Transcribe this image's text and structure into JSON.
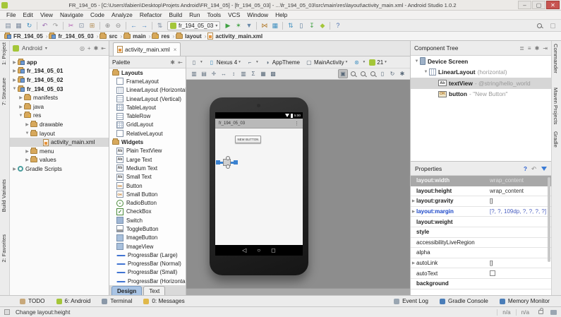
{
  "window": {
    "title": "FR_194_05 - [C:\\Users\\fabien\\Desktop\\Projets Android\\FR_194_05] - [fr_194_05_03] - ...\\fr_194_05_03\\src\\main\\res\\layout\\activity_main.xml - Android Studio 1.0.2"
  },
  "menu_bar": {
    "items": [
      "File",
      "Edit",
      "View",
      "Navigate",
      "Code",
      "Analyze",
      "Refactor",
      "Build",
      "Run",
      "Tools",
      "VCS",
      "Window",
      "Help"
    ]
  },
  "toolbar": {
    "run_config": "fr_194_05_03",
    "icons": [
      {
        "name": "open-icon",
        "glyph": "▤",
        "color": "#7d8ca0"
      },
      {
        "name": "save-icon",
        "glyph": "▦",
        "color": "#7d8ca0"
      },
      {
        "name": "sync-icon",
        "glyph": "↻",
        "color": "#3f8fc0"
      },
      {
        "name": "sep"
      },
      {
        "name": "undo-icon",
        "glyph": "↶",
        "color": "#9a68b0"
      },
      {
        "name": "redo-icon",
        "glyph": "↷",
        "color": "#9a9a9a"
      },
      {
        "name": "sep"
      },
      {
        "name": "cut-icon",
        "glyph": "✂",
        "color": "#b05ab0"
      },
      {
        "name": "copy-icon",
        "glyph": "⊡",
        "color": "#7d8ca0"
      },
      {
        "name": "paste-icon",
        "glyph": "⊞",
        "color": "#b08a50"
      },
      {
        "name": "sep"
      },
      {
        "name": "find-icon",
        "glyph": "⊕",
        "color": "#8a8a8a"
      },
      {
        "name": "replace-icon",
        "glyph": "⊖",
        "color": "#8a8a8a"
      },
      {
        "name": "sep"
      },
      {
        "name": "back-icon",
        "glyph": "←",
        "color": "#3f7fc0"
      },
      {
        "name": "forward-icon",
        "glyph": "→",
        "color": "#3f7fc0"
      },
      {
        "name": "sep"
      },
      {
        "name": "sort-icon",
        "glyph": "⇅",
        "color": "#7d8ca0"
      },
      {
        "name": "run-config-box"
      },
      {
        "name": "run-icon",
        "glyph": "▶",
        "color": "#3fa142"
      },
      {
        "name": "debug-icon",
        "glyph": "✶",
        "color": "#3fa142"
      },
      {
        "name": "install-icon",
        "glyph": "▼",
        "color": "#6888a8"
      },
      {
        "name": "sep"
      },
      {
        "name": "attach-debugger-icon",
        "glyph": "⋈",
        "color": "#b07828"
      },
      {
        "name": "avd-manager-icon",
        "glyph": "▦",
        "color": "#3f8fc0"
      },
      {
        "name": "sep"
      },
      {
        "name": "sync-gradle-icon",
        "glyph": "⇅",
        "color": "#3f8fc0"
      },
      {
        "name": "device-monitor-icon",
        "glyph": "▯",
        "color": "#5a7a9a"
      },
      {
        "name": "sdk-manager-icon",
        "glyph": "↧",
        "color": "#3fa142"
      },
      {
        "name": "android-icon",
        "glyph": "◆",
        "color": "#a4c639"
      },
      {
        "name": "sep"
      },
      {
        "name": "help-icon",
        "glyph": "?",
        "color": "#4a6fb0"
      }
    ]
  },
  "breadcrumbs": {
    "items": [
      "FR_194_05",
      "fr_194_05_03",
      "src",
      "main",
      "res",
      "layout",
      "activity_main.xml"
    ]
  },
  "left_stripe": {
    "top": [
      "1: Project",
      "7: Structure"
    ],
    "bottom": [
      "Build Variants",
      "2: Favorites"
    ]
  },
  "right_stripe": {
    "items": [
      "Commander",
      "Maven Projects",
      "Gradle"
    ]
  },
  "project_panel": {
    "header": "Android",
    "tree": [
      {
        "label": "app",
        "indent": 1,
        "arrow": "c",
        "icon": "mod",
        "bold": true
      },
      {
        "label": "fr_194_05_01",
        "indent": 1,
        "arrow": "c",
        "icon": "mod",
        "bold": true
      },
      {
        "label": "fr_194_05_02",
        "indent": 1,
        "arrow": "c",
        "icon": "mod",
        "bold": true
      },
      {
        "label": "fr_194_05_03",
        "indent": 1,
        "arrow": "e",
        "icon": "mod",
        "bold": true
      },
      {
        "label": "manifests",
        "indent": 2,
        "arrow": "c",
        "icon": "fold"
      },
      {
        "label": "java",
        "indent": 2,
        "arrow": "c",
        "icon": "fold"
      },
      {
        "label": "res",
        "indent": 2,
        "arrow": "e",
        "icon": "res"
      },
      {
        "label": "drawable",
        "indent": 3,
        "arrow": "c",
        "icon": "fold"
      },
      {
        "label": "layout",
        "indent": 3,
        "arrow": "e",
        "icon": "fold"
      },
      {
        "label": "activity_main.xml",
        "indent": 5,
        "arrow": "n",
        "icon": "xml",
        "selected": true
      },
      {
        "label": "menu",
        "indent": 3,
        "arrow": "c",
        "icon": "fold"
      },
      {
        "label": "values",
        "indent": 3,
        "arrow": "c",
        "icon": "fold"
      },
      {
        "label": "Gradle Scripts",
        "indent": 1,
        "arrow": "c",
        "icon": "gradle"
      }
    ]
  },
  "editor": {
    "tab": "activity_main.xml",
    "bottom_tabs": [
      "Design",
      "Text"
    ],
    "active_bottom_tab": "Design"
  },
  "palette": {
    "title": "Palette",
    "sections": [
      {
        "title": "Layouts",
        "items": [
          {
            "label": "FrameLayout",
            "icon": "box"
          },
          {
            "label": "LinearLayout (Horizontal)",
            "icon": "cols"
          },
          {
            "label": "LinearLayout (Vertical)",
            "icon": "rows"
          },
          {
            "label": "TableLayout",
            "icon": "grid"
          },
          {
            "label": "TableRow",
            "icon": "rows"
          },
          {
            "label": "GridLayout",
            "icon": "grid"
          },
          {
            "label": "RelativeLayout",
            "icon": "box"
          }
        ]
      },
      {
        "title": "Widgets",
        "items": [
          {
            "label": "Plain TextView",
            "icon": "ab"
          },
          {
            "label": "Large Text",
            "icon": "ab"
          },
          {
            "label": "Medium Text",
            "icon": "ab"
          },
          {
            "label": "Small Text",
            "icon": "ab"
          },
          {
            "label": "Button",
            "icon": "ok"
          },
          {
            "label": "Small Button",
            "icon": "ok"
          },
          {
            "label": "RadioButton",
            "icon": "radio"
          },
          {
            "label": "CheckBox",
            "icon": "check"
          },
          {
            "label": "Switch",
            "icon": "switch"
          },
          {
            "label": "ToggleButton",
            "icon": "toggle"
          },
          {
            "label": "ImageButton",
            "icon": "img"
          },
          {
            "label": "ImageView",
            "icon": "img"
          },
          {
            "label": "ProgressBar (Large)",
            "icon": "prog"
          },
          {
            "label": "ProgressBar (Normal)",
            "icon": "prog"
          },
          {
            "label": "ProgressBar (Small)",
            "icon": "prog"
          },
          {
            "label": "ProgressBar (Horizontal)",
            "icon": "prog"
          }
        ]
      }
    ]
  },
  "design_toolbar": {
    "device_label": "Nexus 4",
    "theme_label": "AppTheme",
    "activity_label": "MainActivity",
    "api_label": "21",
    "row2_icons": [
      "linear-vertical-icon",
      "table-icon",
      "expand-to-fit-icon",
      "center-horizontal-icon",
      "center-vertical-icon",
      "columns-icon",
      "sigma-icon",
      "grid-icon",
      "grid-snap-icon"
    ],
    "zoom_icons": [
      "zoom-fit-icon",
      "zoom-actual-icon",
      "zoom-in-icon",
      "zoom-out-icon",
      "device-frame-icon",
      "refresh-icon",
      "settings-gear-icon"
    ]
  },
  "component_tree": {
    "title": "Component Tree",
    "nodes": [
      {
        "name": "Device Screen",
        "detail": "",
        "indent": 0,
        "arrow": "e",
        "icon": "device"
      },
      {
        "name": "LinearLayout",
        "detail": "(horizontal)",
        "indent": 1,
        "arrow": "e",
        "icon": "cols"
      },
      {
        "name": "textView",
        "detail": "- @string/hello_world",
        "indent": 2,
        "arrow": "n",
        "icon": "ab",
        "selected": true
      },
      {
        "name": "button",
        "detail": "- \"New Button\"",
        "indent": 2,
        "arrow": "n",
        "icon": "btn"
      }
    ]
  },
  "properties": {
    "title": "Properties",
    "rows": [
      {
        "name": "layout:width",
        "value": "wrap_content",
        "bold": true,
        "selected": true
      },
      {
        "name": "layout:height",
        "value": "wrap_content",
        "bold": true
      },
      {
        "name": "layout:gravity",
        "value": "[]",
        "bold": true,
        "expandable": true
      },
      {
        "name": "layout:margin",
        "value": "[?, ?, 109dp, ?, ?, ?, ?]",
        "bold": true,
        "blue": true,
        "expandable": true,
        "margin_style": true
      },
      {
        "name": "layout:weight",
        "value": "",
        "bold": true
      },
      {
        "name": "style",
        "value": "",
        "bold": true
      },
      {
        "name": "accessibilityLiveRegion",
        "value": ""
      },
      {
        "name": "alpha",
        "value": ""
      },
      {
        "name": "autoLink",
        "value": "[]",
        "expandable": true
      },
      {
        "name": "autoText",
        "value": "",
        "checkbox": true
      },
      {
        "name": "background",
        "value": "",
        "bold": true
      }
    ]
  },
  "preview": {
    "app_title": "fr_194_05_03",
    "time": "5:00",
    "button_label": "NEW BUTTON",
    "nav_back": "◁",
    "nav_home": "○",
    "nav_recents": "◻"
  },
  "bottom_bar": {
    "left": [
      {
        "label": "TODO",
        "icon": "todo",
        "color": "#c8a87a"
      },
      {
        "label": "6: Android",
        "icon": "android",
        "color": "#a4c639"
      },
      {
        "label": "Terminal",
        "icon": "terminal",
        "color": "#8a98a8"
      },
      {
        "label": "0: Messages",
        "icon": "messages",
        "color": "#e0b84a"
      }
    ],
    "right": [
      {
        "label": "Event Log",
        "icon": "event-log",
        "color": "#9aa6b2"
      },
      {
        "label": "Gradle Console",
        "icon": "gradle-console",
        "color": "#4a7db8"
      },
      {
        "label": "Memory Monitor",
        "icon": "memory-monitor",
        "color": "#4a7db8"
      }
    ]
  },
  "status_bar": {
    "message": "Change layout:height",
    "na1": "n/a",
    "na2": "n/a"
  },
  "colors": {
    "android_green": "#a4c639",
    "run_green": "#3fa142",
    "close_red": "#c75450",
    "canvas_gray": "#8d8d8d",
    "selection_gray": "#d6d6d6",
    "margin_blue": "#1a46c8",
    "design_tab_blue": "#a9c4e4",
    "selection_handle_blue": "#3b82d0"
  }
}
